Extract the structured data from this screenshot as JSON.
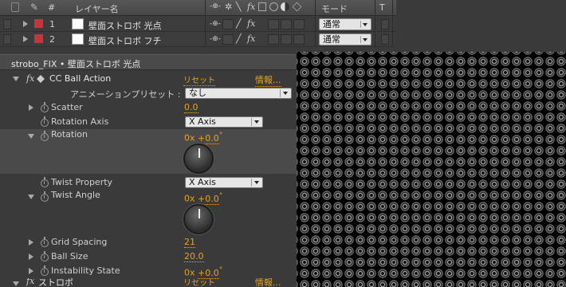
{
  "timeline": {
    "header": {
      "number_col": "#",
      "layer_name_col": "レイヤー名",
      "switches_icons": [
        "shy-icon",
        "collapse-icon",
        "quality-icon",
        "fx-icon",
        "frame-blend-icon",
        "motion-blur-icon",
        "adjustment-icon",
        "3d-icon"
      ],
      "fx_label": "fx",
      "mode_col": "モード",
      "trackmatte_col": "T"
    },
    "layers": [
      {
        "num": "1",
        "name": "壁面ストロボ 光点",
        "color": "#c4363b",
        "fx": "fx",
        "mode": "通常"
      },
      {
        "num": "2",
        "name": "壁面ストロボ フチ",
        "color": "#c4363b",
        "fx": "fx",
        "mode": "通常"
      }
    ]
  },
  "effects_panel": {
    "title": "strobo_FIX • 壁面ストロボ 光点",
    "effect": {
      "fx_label": "fx",
      "name": "CC Ball Action",
      "reset": "リセット",
      "about": "情報..."
    },
    "preset": {
      "label": "アニメーションプリセット :",
      "value": "なし"
    },
    "properties": {
      "scatter": {
        "label": "Scatter",
        "value": "0.0"
      },
      "rotation_axis": {
        "label": "Rotation Axis",
        "value": "X Axis"
      },
      "rotation": {
        "label": "Rotation",
        "revs": "0x",
        "degrees": "+0.0",
        "unit": "°"
      },
      "twist_property": {
        "label": "Twist Property",
        "value": "X Axis"
      },
      "twist_angle": {
        "label": "Twist Angle",
        "revs": "0x",
        "degrees": "+0.0",
        "unit": "°"
      },
      "grid_spacing": {
        "label": "Grid Spacing",
        "value": "21"
      },
      "ball_size": {
        "label": "Ball Size",
        "value": "20.0"
      },
      "instability_state": {
        "label": "Instability State",
        "revs": "0x",
        "degrees": "+0.0",
        "unit": "°"
      }
    },
    "next_effect": {
      "fx_label": "fx",
      "name": "ストロボ",
      "reset": "リセット",
      "about": "情報..."
    }
  },
  "colors": {
    "accent_orange": "#e3a325",
    "label_red": "#c4363b"
  }
}
